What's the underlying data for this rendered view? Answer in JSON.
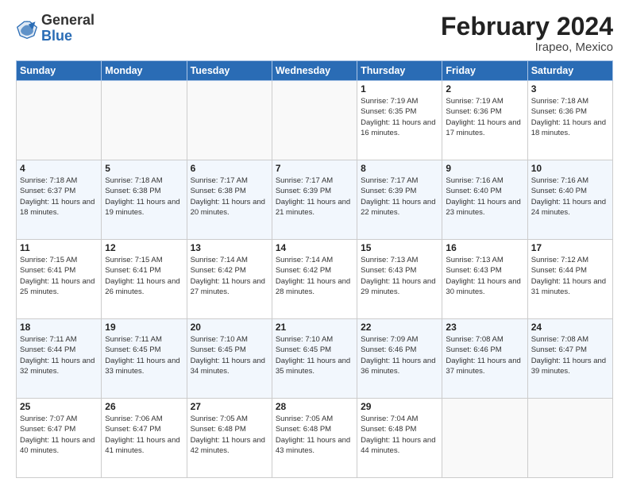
{
  "header": {
    "logo_general": "General",
    "logo_blue": "Blue",
    "title": "February 2024",
    "location": "Irapeo, Mexico"
  },
  "weekdays": [
    "Sunday",
    "Monday",
    "Tuesday",
    "Wednesday",
    "Thursday",
    "Friday",
    "Saturday"
  ],
  "weeks": [
    [
      {
        "day": "",
        "info": ""
      },
      {
        "day": "",
        "info": ""
      },
      {
        "day": "",
        "info": ""
      },
      {
        "day": "",
        "info": ""
      },
      {
        "day": "1",
        "info": "Sunrise: 7:19 AM\nSunset: 6:35 PM\nDaylight: 11 hours and 16 minutes."
      },
      {
        "day": "2",
        "info": "Sunrise: 7:19 AM\nSunset: 6:36 PM\nDaylight: 11 hours and 17 minutes."
      },
      {
        "day": "3",
        "info": "Sunrise: 7:18 AM\nSunset: 6:36 PM\nDaylight: 11 hours and 18 minutes."
      }
    ],
    [
      {
        "day": "4",
        "info": "Sunrise: 7:18 AM\nSunset: 6:37 PM\nDaylight: 11 hours and 18 minutes."
      },
      {
        "day": "5",
        "info": "Sunrise: 7:18 AM\nSunset: 6:38 PM\nDaylight: 11 hours and 19 minutes."
      },
      {
        "day": "6",
        "info": "Sunrise: 7:17 AM\nSunset: 6:38 PM\nDaylight: 11 hours and 20 minutes."
      },
      {
        "day": "7",
        "info": "Sunrise: 7:17 AM\nSunset: 6:39 PM\nDaylight: 11 hours and 21 minutes."
      },
      {
        "day": "8",
        "info": "Sunrise: 7:17 AM\nSunset: 6:39 PM\nDaylight: 11 hours and 22 minutes."
      },
      {
        "day": "9",
        "info": "Sunrise: 7:16 AM\nSunset: 6:40 PM\nDaylight: 11 hours and 23 minutes."
      },
      {
        "day": "10",
        "info": "Sunrise: 7:16 AM\nSunset: 6:40 PM\nDaylight: 11 hours and 24 minutes."
      }
    ],
    [
      {
        "day": "11",
        "info": "Sunrise: 7:15 AM\nSunset: 6:41 PM\nDaylight: 11 hours and 25 minutes."
      },
      {
        "day": "12",
        "info": "Sunrise: 7:15 AM\nSunset: 6:41 PM\nDaylight: 11 hours and 26 minutes."
      },
      {
        "day": "13",
        "info": "Sunrise: 7:14 AM\nSunset: 6:42 PM\nDaylight: 11 hours and 27 minutes."
      },
      {
        "day": "14",
        "info": "Sunrise: 7:14 AM\nSunset: 6:42 PM\nDaylight: 11 hours and 28 minutes."
      },
      {
        "day": "15",
        "info": "Sunrise: 7:13 AM\nSunset: 6:43 PM\nDaylight: 11 hours and 29 minutes."
      },
      {
        "day": "16",
        "info": "Sunrise: 7:13 AM\nSunset: 6:43 PM\nDaylight: 11 hours and 30 minutes."
      },
      {
        "day": "17",
        "info": "Sunrise: 7:12 AM\nSunset: 6:44 PM\nDaylight: 11 hours and 31 minutes."
      }
    ],
    [
      {
        "day": "18",
        "info": "Sunrise: 7:11 AM\nSunset: 6:44 PM\nDaylight: 11 hours and 32 minutes."
      },
      {
        "day": "19",
        "info": "Sunrise: 7:11 AM\nSunset: 6:45 PM\nDaylight: 11 hours and 33 minutes."
      },
      {
        "day": "20",
        "info": "Sunrise: 7:10 AM\nSunset: 6:45 PM\nDaylight: 11 hours and 34 minutes."
      },
      {
        "day": "21",
        "info": "Sunrise: 7:10 AM\nSunset: 6:45 PM\nDaylight: 11 hours and 35 minutes."
      },
      {
        "day": "22",
        "info": "Sunrise: 7:09 AM\nSunset: 6:46 PM\nDaylight: 11 hours and 36 minutes."
      },
      {
        "day": "23",
        "info": "Sunrise: 7:08 AM\nSunset: 6:46 PM\nDaylight: 11 hours and 37 minutes."
      },
      {
        "day": "24",
        "info": "Sunrise: 7:08 AM\nSunset: 6:47 PM\nDaylight: 11 hours and 39 minutes."
      }
    ],
    [
      {
        "day": "25",
        "info": "Sunrise: 7:07 AM\nSunset: 6:47 PM\nDaylight: 11 hours and 40 minutes."
      },
      {
        "day": "26",
        "info": "Sunrise: 7:06 AM\nSunset: 6:47 PM\nDaylight: 11 hours and 41 minutes."
      },
      {
        "day": "27",
        "info": "Sunrise: 7:05 AM\nSunset: 6:48 PM\nDaylight: 11 hours and 42 minutes."
      },
      {
        "day": "28",
        "info": "Sunrise: 7:05 AM\nSunset: 6:48 PM\nDaylight: 11 hours and 43 minutes."
      },
      {
        "day": "29",
        "info": "Sunrise: 7:04 AM\nSunset: 6:48 PM\nDaylight: 11 hours and 44 minutes."
      },
      {
        "day": "",
        "info": ""
      },
      {
        "day": "",
        "info": ""
      }
    ]
  ]
}
